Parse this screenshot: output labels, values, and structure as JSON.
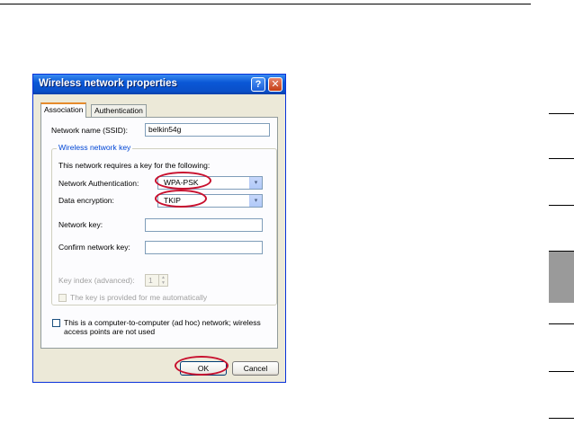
{
  "dialog": {
    "title": "Wireless network properties",
    "help_glyph": "?",
    "close_glyph": "✕"
  },
  "tabs": [
    {
      "label": "Association"
    },
    {
      "label": "Authentication"
    }
  ],
  "association": {
    "ssid_label": "Network name (SSID):",
    "ssid_value": "belkin54g",
    "group_title": "Wireless network key",
    "key_intro": "This network requires a key for the following:",
    "auth_label": "Network Authentication:",
    "auth_value": "WPA-PSK",
    "encryption_label": "Data encryption:",
    "encryption_value": "TKIP",
    "network_key_label": "Network key:",
    "network_key_value": "",
    "confirm_key_label": "Confirm network key:",
    "confirm_key_value": "",
    "key_index_label": "Key index (advanced):",
    "key_index_value": "1",
    "auto_key_label": "The key is provided for me automatically",
    "adhoc_label_line1": "This is a computer-to-computer (ad hoc) network; wireless",
    "adhoc_label_line2": "access points are not used"
  },
  "buttons": {
    "ok": "OK",
    "cancel": "Cancel"
  },
  "colors": {
    "highlight_ellipse": "#c8102e",
    "titlebar": "#0a57d6"
  },
  "icons": {
    "dropdown": "▾",
    "spin_up": "▲",
    "spin_down": "▼"
  }
}
